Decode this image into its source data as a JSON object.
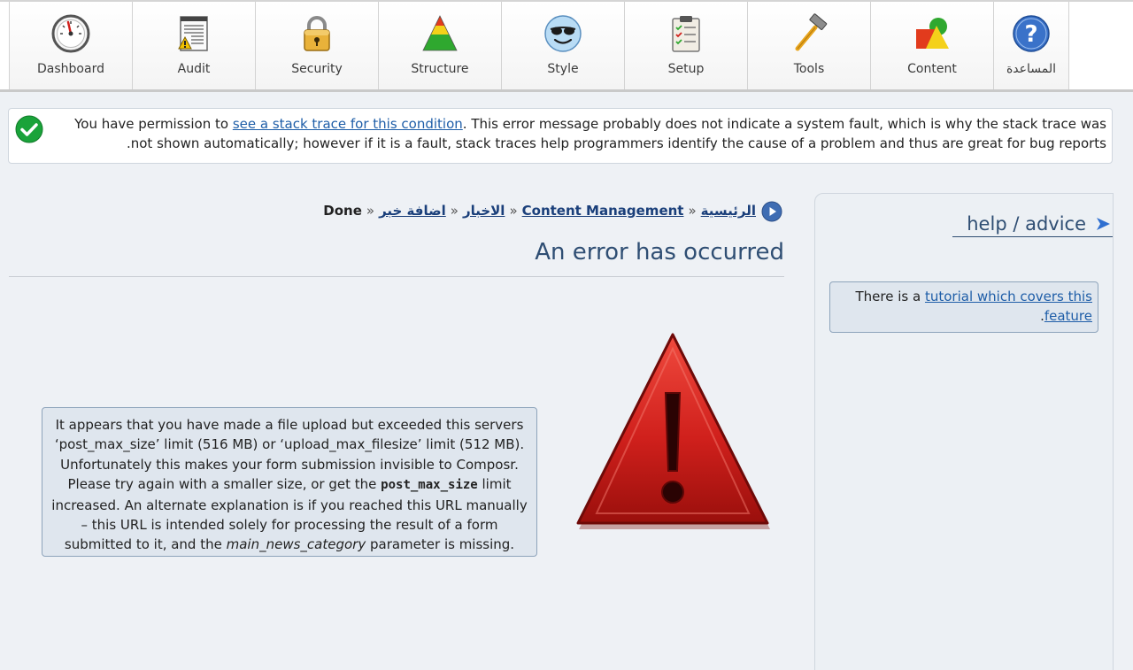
{
  "toolbar": {
    "items": [
      {
        "label": "Dashboard",
        "icon": "gauge-icon"
      },
      {
        "label": "Audit",
        "icon": "audit-report-icon"
      },
      {
        "label": "Security",
        "icon": "padlock-icon"
      },
      {
        "label": "Structure",
        "icon": "triangle-structure-icon"
      },
      {
        "label": "Style",
        "icon": "smiley-sunglasses-icon"
      },
      {
        "label": "Setup",
        "icon": "clipboard-checklist-icon"
      },
      {
        "label": "Tools",
        "icon": "hammer-icon"
      },
      {
        "label": "Content",
        "icon": "shapes-icon"
      },
      {
        "label": "المساعدة",
        "icon": "help-question-icon"
      }
    ]
  },
  "notice": {
    "prefix": "You have permission to ",
    "link": "see a stack trace for this condition",
    "suffix": ". This error message probably does not indicate a system fault, which is why the stack trace was not shown automatically; however if it is a fault, stack traces help programmers identify the cause of a problem and thus are great for bug reports."
  },
  "breadcrumb": {
    "items": [
      "الرئيسية",
      "Content Management",
      "الاخبار",
      "اضافة خبر"
    ],
    "separator": "«",
    "current": "Done"
  },
  "page_title": "An error has occurred",
  "error": {
    "line1": "It appears that you have made a file upload but exceeded this servers ‘post_max_size’ limit (516 MB) or ‘upload_max_filesize’ limit (512 MB). Unfortunately this makes your form submission invisible to Composr. Please try again with a smaller size, or get the ",
    "code": "post_max_size",
    "line2": " limit increased. An alternate explanation is if you reached this URL manually – this URL is intended solely for processing the result of a form submitted to it, and the ",
    "param": "main_news_category",
    "line3": " parameter is missing."
  },
  "side": {
    "help_title": "help / advice",
    "tutorial_prefix": "There is a ",
    "tutorial_link": "tutorial which covers this feature",
    "tutorial_suffix": "."
  },
  "colors": {
    "accent": "#2f4e73",
    "link": "#1f5ea8",
    "box_bg": "#dfe6ee",
    "error_red": "#d0201c",
    "ok_green": "#1aa33a"
  }
}
